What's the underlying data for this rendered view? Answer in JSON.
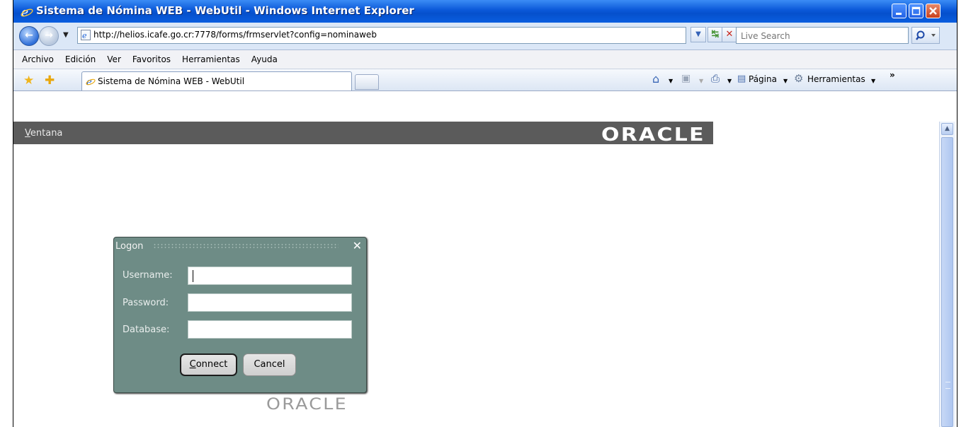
{
  "window": {
    "title": "Sistema de Nómina WEB - WebUtil - Windows Internet Explorer"
  },
  "addressbar": {
    "url": "http://helios.icafe.go.cr:7778/forms/frmservlet?config=nominaweb",
    "search_placeholder": "Live Search"
  },
  "menu": [
    "Archivo",
    "Edición",
    "Ver",
    "Favoritos",
    "Herramientas",
    "Ayuda"
  ],
  "tab": {
    "title": "Sistema de Nómina WEB - WebUtil"
  },
  "commandbar": {
    "page_label": "Página",
    "tools_label": "Herramientas"
  },
  "app": {
    "menu_label": "Ventana",
    "menu_accel": "V",
    "menu_rest": "entana",
    "brand": "ORACLE"
  },
  "logon": {
    "title": "Logon",
    "username_label": "Username:",
    "password_label": "Password:",
    "database_label": "Database:",
    "connect_label": "Connect",
    "connect_accel": "C",
    "connect_rest": "onnect",
    "cancel_label": "Cancel"
  },
  "footer_brand": "ORACLE",
  "colors": {
    "titlebar": "#0a58d8",
    "app_menubar": "#5b5b5b",
    "dialog": "#6e8c86"
  }
}
